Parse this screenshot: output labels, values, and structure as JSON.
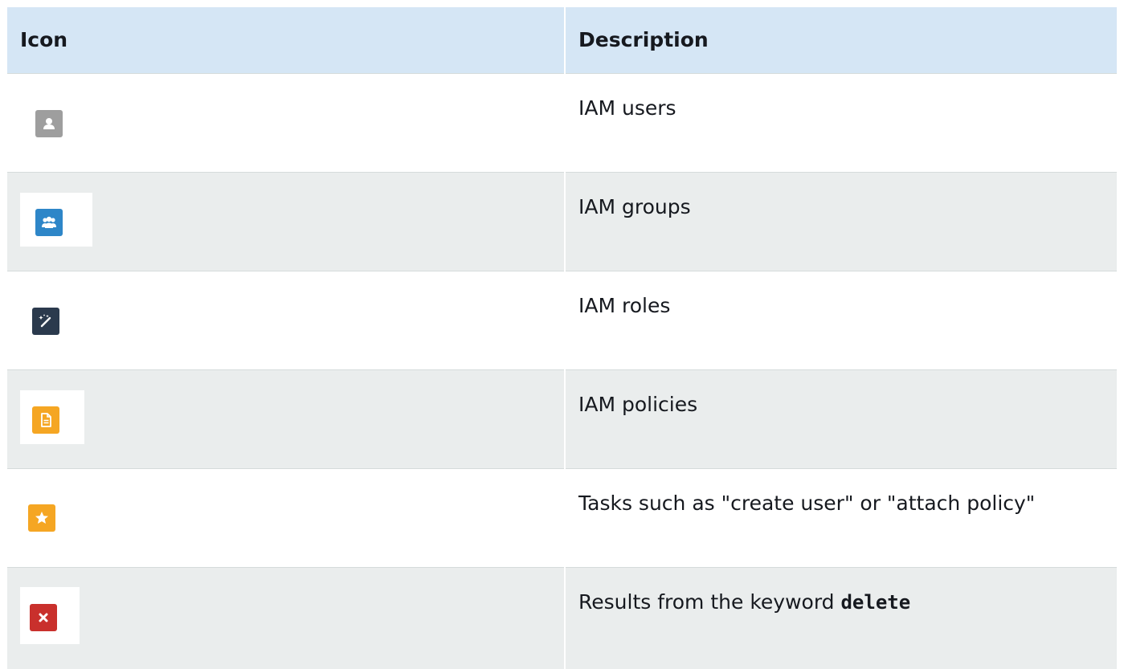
{
  "table": {
    "headers": {
      "icon": "Icon",
      "description": "Description"
    },
    "rows": [
      {
        "icon": "user-icon",
        "icon_color": "#9e9e9e",
        "description": "IAM users",
        "keyword": ""
      },
      {
        "icon": "group-icon",
        "icon_color": "#2e86c8",
        "description": "IAM groups",
        "keyword": ""
      },
      {
        "icon": "role-wand-icon",
        "icon_color": "#2b3a4d",
        "description": "IAM roles",
        "keyword": ""
      },
      {
        "icon": "policy-document-icon",
        "icon_color": "#f5a623",
        "description": "IAM policies",
        "keyword": ""
      },
      {
        "icon": "task-star-icon",
        "icon_color": "#f5a623",
        "description": "Tasks such as \"create user\" or \"attach policy\"",
        "keyword": ""
      },
      {
        "icon": "delete-x-icon",
        "icon_color": "#c9302c",
        "description": "Results from the keyword ",
        "keyword": "delete"
      }
    ]
  }
}
